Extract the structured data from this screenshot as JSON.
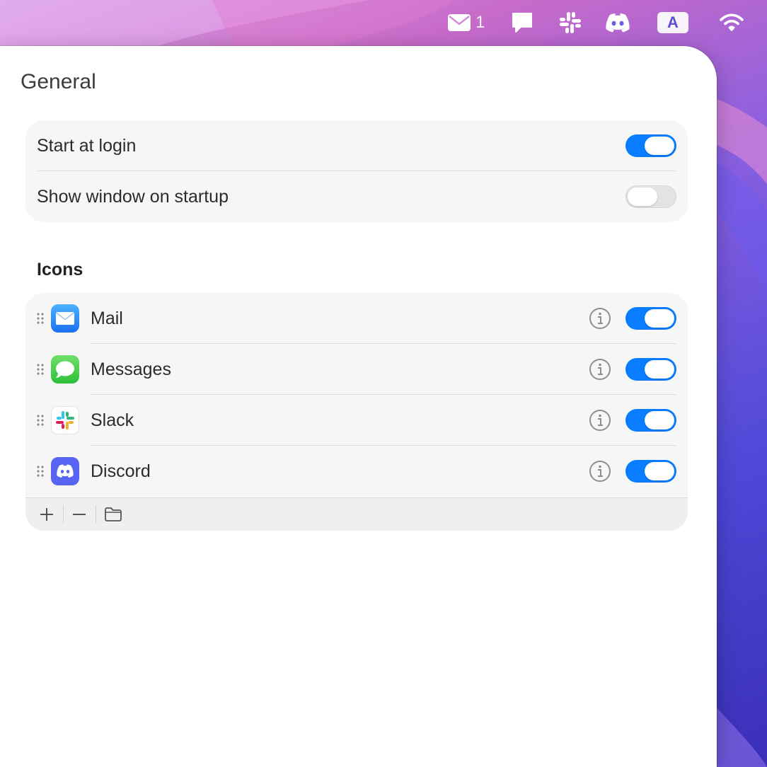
{
  "menubar": {
    "items": [
      {
        "icon": "mail-icon",
        "badge": "1"
      },
      {
        "icon": "messages-icon"
      },
      {
        "icon": "slack-icon"
      },
      {
        "icon": "discord-icon"
      },
      {
        "icon": "input-source-icon",
        "label": "A"
      },
      {
        "icon": "wifi-icon"
      }
    ]
  },
  "window": {
    "title": "General",
    "general_settings": [
      {
        "label": "Start at login",
        "enabled": true
      },
      {
        "label": "Show window on startup",
        "enabled": false
      }
    ],
    "icons_heading": "Icons",
    "apps": [
      {
        "name": "Mail",
        "icon": "mail-app-icon",
        "enabled": true
      },
      {
        "name": "Messages",
        "icon": "messages-app-icon",
        "enabled": true
      },
      {
        "name": "Slack",
        "icon": "slack-app-icon",
        "enabled": true
      },
      {
        "name": "Discord",
        "icon": "discord-app-icon",
        "enabled": true
      }
    ],
    "footer_buttons": [
      "add",
      "remove",
      "folder"
    ]
  },
  "colors": {
    "accent": "#0a7cff",
    "toggle_off": "#e3e3e3",
    "group_bg": "#f6f6f6"
  }
}
